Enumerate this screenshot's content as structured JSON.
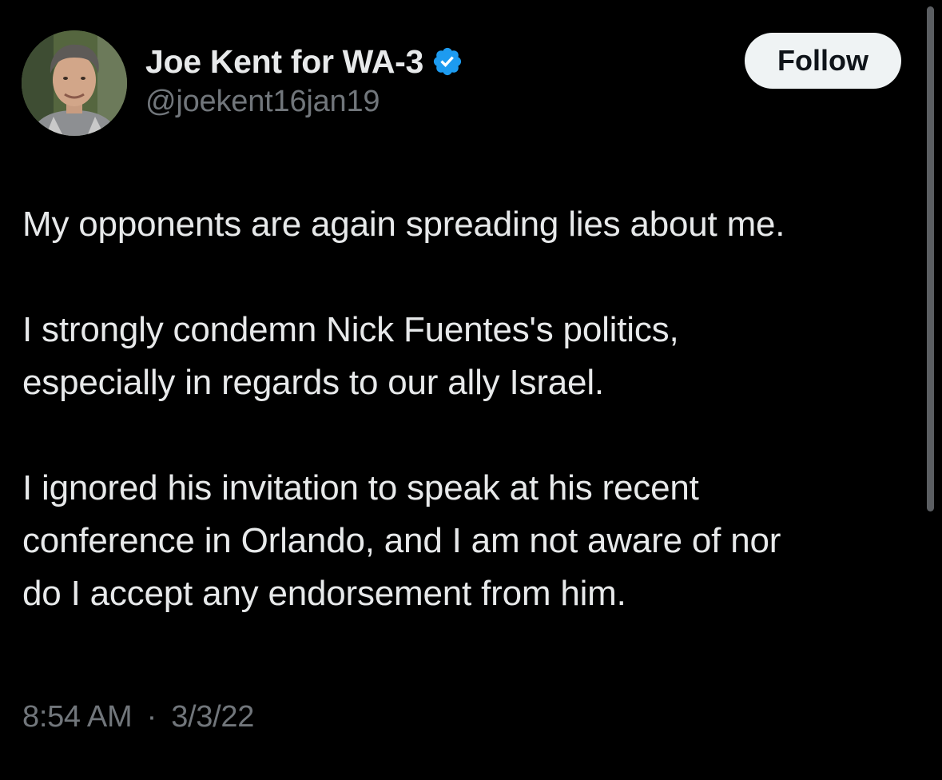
{
  "tweet": {
    "display_name": "Joe Kent for WA-3",
    "handle": "@joekent16jan19",
    "verified_icon": "verified-badge-icon",
    "follow_label": "Follow",
    "paragraphs": [
      [
        "My opponents are again spreading lies about me."
      ],
      [
        "I strongly condemn Nick Fuentes's politics,",
        "especially in regards to our ally Israel."
      ],
      [
        "I ignored his invitation to speak at his recent",
        "conference in Orlando, and I am not aware of nor",
        "do I accept any endorsement from him."
      ]
    ],
    "time": "8:54 AM",
    "separator": "·",
    "date": "3/3/22"
  },
  "colors": {
    "background": "#000000",
    "text_primary": "#e7e9ea",
    "text_secondary": "#71767b",
    "verified_blue": "#1d9bf0",
    "follow_bg": "#eff3f4",
    "follow_text": "#0f1419"
  }
}
